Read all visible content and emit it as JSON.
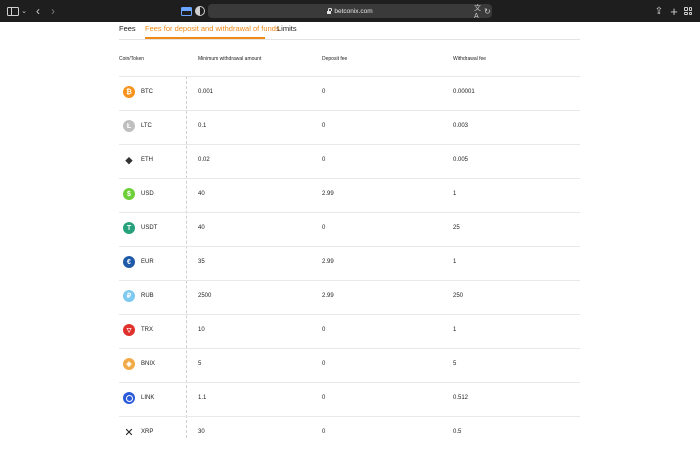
{
  "browser": {
    "url": "betconix.com",
    "icons": [
      "sidebar-icon",
      "chevron-down-icon",
      "back-icon",
      "forward-icon",
      "tab-overview-icon",
      "privacy-icon",
      "lock-icon",
      "translate-icon",
      "reload-icon",
      "share-icon",
      "new-tab-icon",
      "tabs-grid-icon"
    ]
  },
  "tabs": [
    {
      "label": "Fees"
    },
    {
      "label": "Fees for deposit and withdrawal of funds",
      "active": true
    },
    {
      "label": "Limits"
    }
  ],
  "accent_color": "#ef8a17",
  "table": {
    "headers": [
      "Coin/Token",
      "Minimum withdrawal amount",
      "Deposit fee",
      "Withdrawal fee"
    ],
    "rows": [
      {
        "symbol": "BTC",
        "min": "0.001",
        "deposit": "0",
        "withdrawal": "0.00001",
        "icon": "bitcoin-icon",
        "color": "#f7931a"
      },
      {
        "symbol": "LTC",
        "min": "0.1",
        "deposit": "0",
        "withdrawal": "0.003",
        "icon": "litecoin-icon",
        "color": "#bfbfbf"
      },
      {
        "symbol": "ETH",
        "min": "0.02",
        "deposit": "0",
        "withdrawal": "0.005",
        "icon": "ethereum-icon",
        "color": "#333333"
      },
      {
        "symbol": "USD",
        "min": "40",
        "deposit": "2.99",
        "withdrawal": "1",
        "icon": "dollar-icon",
        "color": "#6fcf39"
      },
      {
        "symbol": "USDT",
        "min": "40",
        "deposit": "0",
        "withdrawal": "25",
        "icon": "tether-icon",
        "color": "#26a17b"
      },
      {
        "symbol": "EUR",
        "min": "35",
        "deposit": "2.99",
        "withdrawal": "1",
        "icon": "euro-icon",
        "color": "#1f5aa8"
      },
      {
        "symbol": "RUB",
        "min": "2500",
        "deposit": "2.99",
        "withdrawal": "250",
        "icon": "ruble-icon",
        "color": "#7ec9f0"
      },
      {
        "symbol": "TRX",
        "min": "10",
        "deposit": "0",
        "withdrawal": "1",
        "icon": "tron-icon",
        "color": "#e0322d"
      },
      {
        "symbol": "BNIX",
        "min": "5",
        "deposit": "0",
        "withdrawal": "5",
        "icon": "bnix-icon",
        "color": "#f2a948"
      },
      {
        "symbol": "LINK",
        "min": "1.1",
        "deposit": "0",
        "withdrawal": "0.512",
        "icon": "chainlink-icon",
        "color": "#2a5ada"
      },
      {
        "symbol": "XRP",
        "min": "30",
        "deposit": "0",
        "withdrawal": "0.5",
        "icon": "xrp-icon",
        "color": "#222222"
      }
    ]
  }
}
